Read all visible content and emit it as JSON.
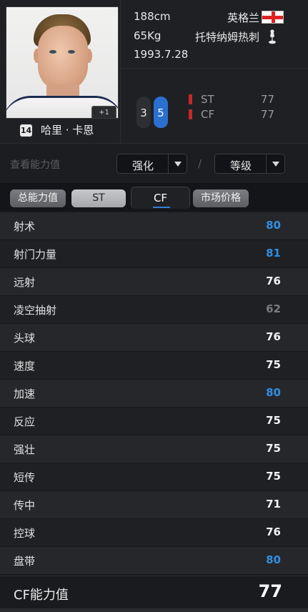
{
  "player": {
    "name": "哈里 · 卡恩",
    "number": "14",
    "photo_badge": "+1",
    "height": "188cm",
    "weight": "65Kg",
    "birth": "1993.7.28",
    "nation": "英格兰",
    "club": "托特纳姆热刺",
    "foot_left": "3",
    "foot_right": "5",
    "positions": [
      {
        "name": "ST",
        "value": "77"
      },
      {
        "name": "CF",
        "value": "77"
      }
    ]
  },
  "controls": {
    "label": "查看能力值",
    "enhance": "强化",
    "divider": "/",
    "level": "等级"
  },
  "tabs": [
    "总能力值",
    "ST",
    "CF",
    "市场价格"
  ],
  "active_tab": "CF",
  "stats": [
    {
      "name": "射术",
      "value": "80",
      "color": "#2f8fe0"
    },
    {
      "name": "射门力量",
      "value": "81",
      "color": "#2f8fe0"
    },
    {
      "name": "远射",
      "value": "76",
      "color": "#f2f2f2"
    },
    {
      "name": "凌空抽射",
      "value": "62",
      "color": "#7b7c80"
    },
    {
      "name": "头球",
      "value": "76",
      "color": "#f2f2f2"
    },
    {
      "name": "速度",
      "value": "75",
      "color": "#f2f2f2"
    },
    {
      "name": "加速",
      "value": "80",
      "color": "#2f8fe0"
    },
    {
      "name": "反应",
      "value": "75",
      "color": "#f2f2f2"
    },
    {
      "name": "强壮",
      "value": "75",
      "color": "#f2f2f2"
    },
    {
      "name": "短传",
      "value": "75",
      "color": "#f2f2f2"
    },
    {
      "name": "传中",
      "value": "71",
      "color": "#f2f2f2"
    },
    {
      "name": "控球",
      "value": "76",
      "color": "#f2f2f2"
    },
    {
      "name": "盘带",
      "value": "80",
      "color": "#2f8fe0"
    }
  ],
  "total": {
    "label": "CF能力值",
    "value": "77"
  }
}
